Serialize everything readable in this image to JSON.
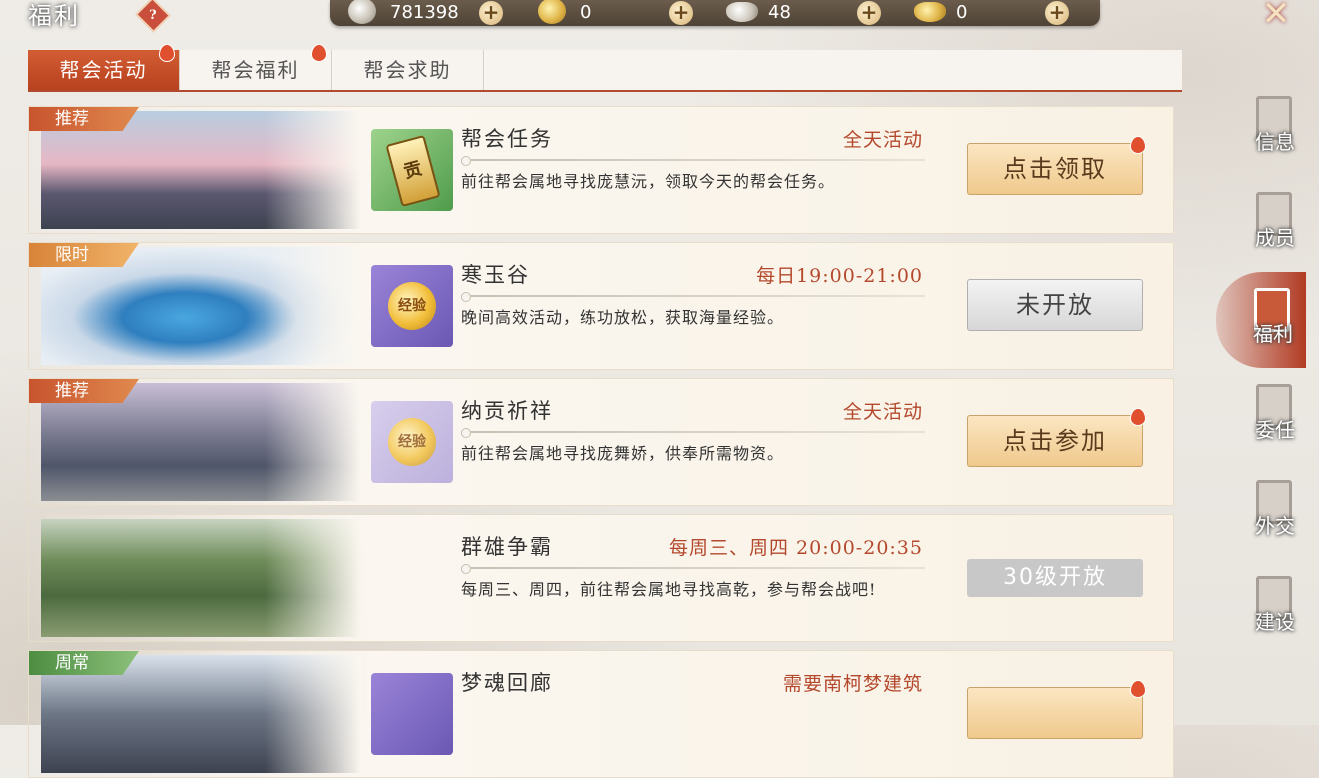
{
  "header": {
    "title": "福利",
    "help_icon": "?",
    "close_icon": "✕"
  },
  "currencies": [
    {
      "icon": "silver-coin-icon",
      "value": "781398"
    },
    {
      "icon": "gold-coin-icon",
      "value": "0"
    },
    {
      "icon": "silver-ingot-icon",
      "value": "48"
    },
    {
      "icon": "gold-ingot-icon",
      "value": "0"
    }
  ],
  "tabs": [
    {
      "label": "帮会活动",
      "active": true,
      "red_dot": true
    },
    {
      "label": "帮会福利",
      "active": false,
      "red_dot": true
    },
    {
      "label": "帮会求助",
      "active": false,
      "red_dot": false
    }
  ],
  "activities": [
    {
      "tag": "推荐",
      "name": "帮会任务",
      "time": "全天活动",
      "desc": "前往帮会属地寻找庞慧沅，领取今天的帮会任务。",
      "button": "点击领取",
      "icon_text": "贡"
    },
    {
      "tag": "限时",
      "name": "寒玉谷",
      "time": "每日19:00-21:00",
      "desc": "晚间高效活动，练功放松，获取海量经验。",
      "button": "未开放",
      "icon_text": "经验"
    },
    {
      "tag": "推荐",
      "name": "纳贡祈祥",
      "time": "全天活动",
      "desc": "前往帮会属地寻找庞舞娇，供奉所需物资。",
      "button": "点击参加",
      "icon_text": "经验"
    },
    {
      "tag": "",
      "name": "群雄争霸",
      "time": "每周三、周四 20:00-20:35",
      "desc": "每周三、周四，前往帮会属地寻找高乾，参与帮会战吧!",
      "button": "30级开放"
    },
    {
      "tag": "周常",
      "name": "梦魂回廊",
      "time": "需要南柯梦建筑",
      "desc": "",
      "button": ""
    }
  ],
  "right_nav": [
    {
      "label": "信息",
      "icon": "info-icon",
      "active": false
    },
    {
      "label": "成员",
      "icon": "members-icon",
      "active": false
    },
    {
      "label": "福利",
      "icon": "welfare-icon",
      "active": true
    },
    {
      "label": "委任",
      "icon": "appoint-icon",
      "active": false
    },
    {
      "label": "外交",
      "icon": "diplomacy-icon",
      "active": false
    },
    {
      "label": "建设",
      "icon": "build-icon",
      "active": false
    }
  ],
  "colors": {
    "accent": "#b8411f",
    "time_text": "#b4482c",
    "button_gold": "#f0c98c"
  }
}
